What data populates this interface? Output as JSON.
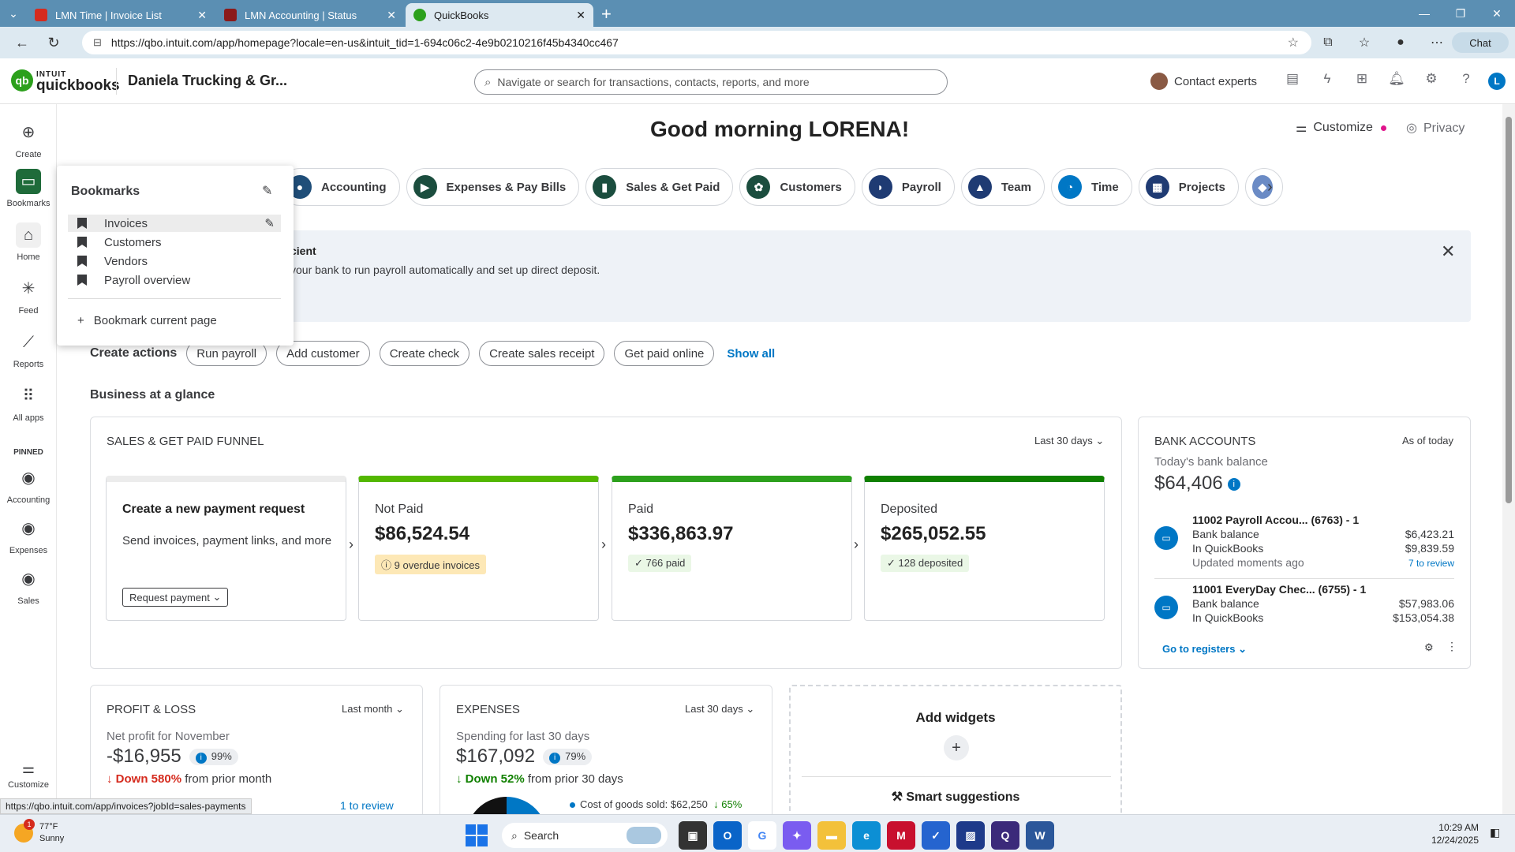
{
  "browser": {
    "tabs": [
      {
        "title": "LMN Time | Invoice List",
        "color": "#d52b1e"
      },
      {
        "title": "LMN Accounting | Status",
        "color": "#8b1a1a"
      },
      {
        "title": "QuickBooks",
        "color": "#2ca01c"
      }
    ],
    "url": "https://qbo.intuit.com/app/homepage?locale=en-us&intuit_tid=1-694c06c2-4e9b0210216f45b4340cc467",
    "chat_label": "Chat"
  },
  "header": {
    "logo_top": "INTUIT",
    "logo_bottom": "quickbooks",
    "company": "Daniela Trucking & Gr...",
    "search_placeholder": "Navigate or search for transactions, contacts, reports, and more",
    "contact_experts": "Contact experts",
    "user_initial": "L"
  },
  "leftnav": {
    "items": [
      {
        "label": "Create",
        "icon": "plus-circle-icon"
      },
      {
        "label": "Bookmarks",
        "icon": "bookmark-icon"
      },
      {
        "label": "Home",
        "icon": "home-icon"
      },
      {
        "label": "Feed",
        "icon": "feed-icon"
      },
      {
        "label": "Reports",
        "icon": "reports-icon"
      },
      {
        "label": "All apps",
        "icon": "grid-icon"
      }
    ],
    "pinned_label": "PINNED",
    "pinned": [
      {
        "label": "Accounting"
      },
      {
        "label": "Expenses"
      },
      {
        "label": "Sales"
      }
    ],
    "customize_label": "Customize"
  },
  "bookmarks": {
    "title": "Bookmarks",
    "items": [
      "Invoices",
      "Customers",
      "Vendors",
      "Payroll overview"
    ],
    "add_label": "Bookmark current page"
  },
  "main": {
    "greeting": "Good morning LORENA!",
    "customize": "Customize",
    "privacy": "Privacy",
    "chips": [
      "Accounting",
      "Expenses & Pay Bills",
      "Sales & Get Paid",
      "Customers",
      "Payroll",
      "Team",
      "Time",
      "Projects"
    ],
    "banner_title": "cient",
    "banner_text": "your bank to run payroll automatically and set up direct deposit.",
    "create_actions_label": "Create actions",
    "create_actions": [
      "Run payroll",
      "Add customer",
      "Create check",
      "Create sales receipt",
      "Get paid online"
    ],
    "show_all": "Show all",
    "business_glance": "Business at a glance"
  },
  "funnel": {
    "title": "SALES & GET PAID FUNNEL",
    "range": "Last 30 days",
    "new_title": "Create a new payment request",
    "new_sub": "Send invoices, payment links, and more",
    "request_btn": "Request payment",
    "not_paid_label": "Not Paid",
    "not_paid_amount": "$86,524.54",
    "not_paid_badge": "9 overdue invoices",
    "paid_label": "Paid",
    "paid_amount": "$336,863.97",
    "paid_badge": "766 paid",
    "deposited_label": "Deposited",
    "deposited_amount": "$265,052.55",
    "deposited_badge": "128 deposited"
  },
  "bank": {
    "title": "BANK ACCOUNTS",
    "as_of": "As of today",
    "sub": "Today's bank balance",
    "total": "$64,406",
    "accounts": [
      {
        "name": "11002 Payroll Accou... (6763) - 1",
        "bank_label": "Bank balance",
        "bank_value": "$6,423.21",
        "qb_label": "In QuickBooks",
        "qb_value": "$9,839.59",
        "updated": "Updated moments ago",
        "review": "7 to review"
      },
      {
        "name": "11001 EveryDay Chec... (6755) - 1",
        "bank_label": "Bank balance",
        "bank_value": "$57,983.06",
        "qb_label": "In QuickBooks",
        "qb_value": "$153,054.38"
      }
    ],
    "goto": "Go to registers"
  },
  "pl": {
    "title": "PROFIT & LOSS",
    "range": "Last month",
    "sub": "Net profit for November",
    "amount": "-$16,955",
    "pct": "99%",
    "change": "Down 580%",
    "change_rest": "from prior month",
    "review": "1 to review"
  },
  "expenses": {
    "title": "EXPENSES",
    "range": "Last 30 days",
    "sub": "Spending for last 30 days",
    "amount": "$167,092",
    "pct": "79%",
    "change": "Down 52%",
    "change_rest": "from prior 30 days",
    "cogs_label": "Cost of goods sold: $62,250",
    "cogs_pct": "65%"
  },
  "widgets": {
    "add": "Add widgets",
    "smart": "Smart suggestions"
  },
  "status_url": "https://qbo.intuit.com/app/invoices?jobId=sales-payments",
  "taskbar": {
    "temp": "77°F",
    "cond": "Sunny",
    "badge": "1",
    "search": "Search",
    "time": "10:29 AM",
    "date": "12/24/2025"
  }
}
